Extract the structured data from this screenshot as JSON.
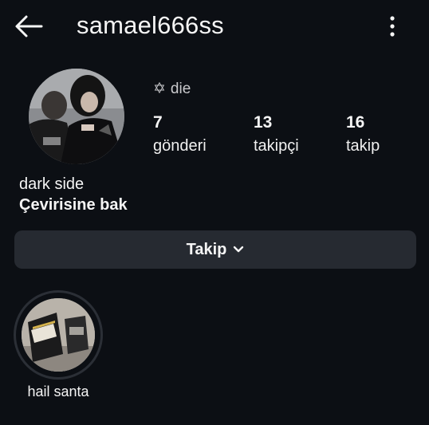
{
  "header": {
    "username": "samael666ss",
    "back_icon": "arrow-left-icon",
    "more_icon": "kebab-menu-icon"
  },
  "profile": {
    "note_symbol": "✡",
    "note": "die",
    "stats": [
      {
        "count": "7",
        "label": "gönderi"
      },
      {
        "count": "13",
        "label": "takipçi"
      },
      {
        "count": "16",
        "label": "takip"
      }
    ],
    "bio": "dark side",
    "translate_link": "Çevirisine bak"
  },
  "actions": {
    "follow_label": "Takip"
  },
  "highlights": [
    {
      "title": "hail santa"
    }
  ],
  "colors": {
    "background": "#0c0f14",
    "button": "#262a31",
    "text": "#f5f5f5"
  }
}
